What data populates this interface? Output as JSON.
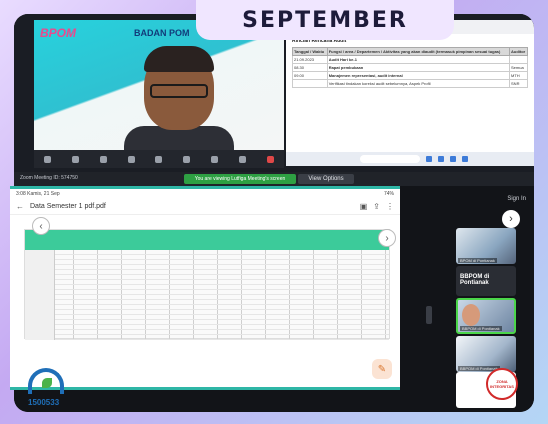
{
  "header": {
    "month": "SEPTEMBER"
  },
  "video": {
    "brand": "BPOM",
    "badan_label": "BADAN POM"
  },
  "document": {
    "title": "Rincian Rencana Audit",
    "columns": [
      "Tanggal / Waktu",
      "Fungsi / area / Departemen / Aktivitas yang akan diaudit (termasuk pimpinan sesuai tugas)",
      "Auditor"
    ],
    "rows": [
      [
        "21.09.2023",
        "Audit Hari ke-1",
        ""
      ],
      [
        "08.30",
        "Rapat pembukaan",
        "Semua"
      ],
      [
        "09.00",
        "Manajemen representasi, audit internal",
        "MTH"
      ],
      [
        "",
        "Verifikasi tindakan koreksi audit sebelumnya, Aspek Profil",
        "SNR"
      ]
    ]
  },
  "meeting": {
    "id_label": "Zoom Meeting ID: 574750",
    "banner": "You are viewing Lutfiga Meeting's screen",
    "view_options": "View Options",
    "sign_in": "Sign In"
  },
  "phone": {
    "time": "3:08 Kamis, 21 Sep",
    "battery": "74%",
    "file_name": "Data Semester 1 pdf.pdf"
  },
  "logo": {
    "number": "1500533"
  },
  "participants": [
    {
      "label": "BPOM di Pontianak"
    },
    {
      "label": "BBPOM di Pontianak"
    },
    {
      "label": "BBPOM di Pontianak"
    },
    {
      "label": "BBPOM di Pontianak"
    },
    {
      "label": ""
    }
  ],
  "stamp": {
    "text": "ZONA INTEGRITAS"
  }
}
